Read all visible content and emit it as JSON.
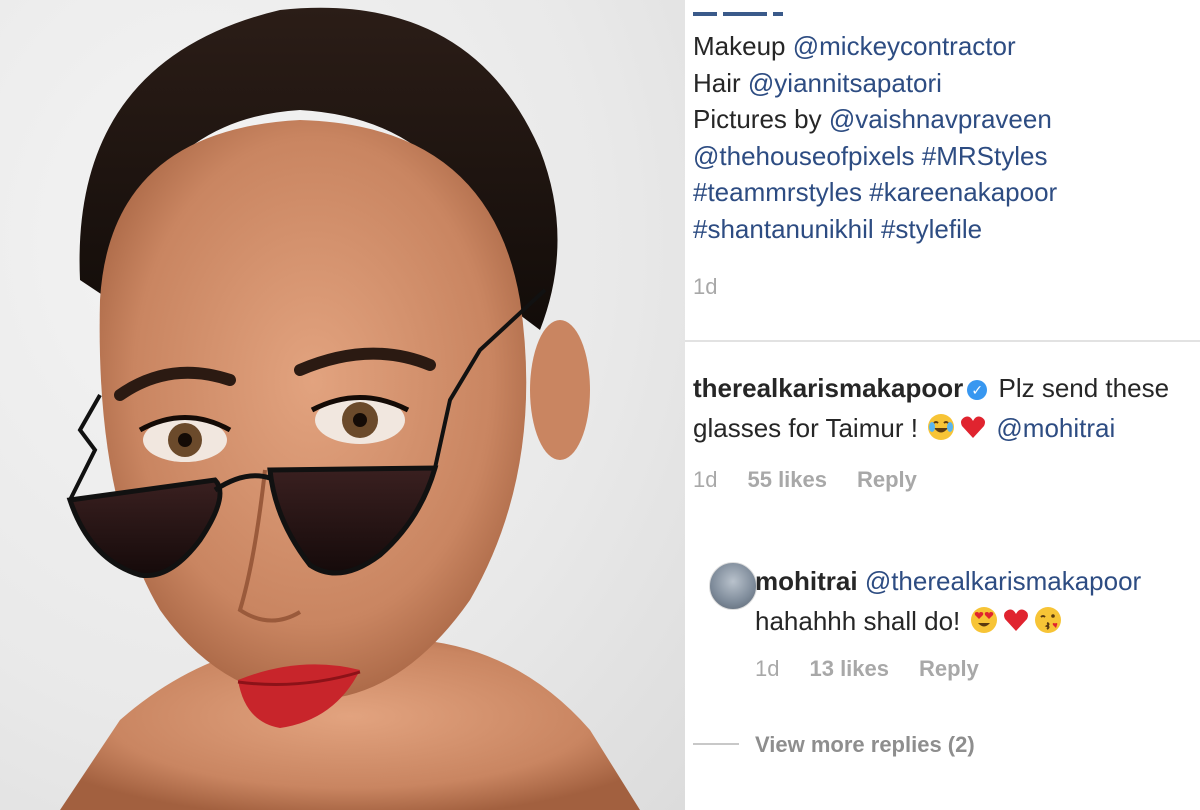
{
  "caption": {
    "lines": [
      [
        {
          "t": "Makeup ",
          "link": false
        },
        {
          "t": "@mickeycontractor",
          "link": true
        }
      ],
      [
        {
          "t": "Hair ",
          "link": false
        },
        {
          "t": "@yiannitsapatori",
          "link": true
        }
      ],
      [
        {
          "t": "Pictures by ",
          "link": false
        },
        {
          "t": "@vaishnavpraveen",
          "link": true
        }
      ],
      [
        {
          "t": "@thehouseofpixels",
          "link": true
        },
        {
          "t": " ",
          "link": false
        },
        {
          "t": "#MRStyles",
          "link": true
        }
      ],
      [
        {
          "t": "#teammrstyles",
          "link": true
        },
        {
          "t": " ",
          "link": false
        },
        {
          "t": "#kareenakapoor",
          "link": true
        }
      ],
      [
        {
          "t": "#shantanunikhil",
          "link": true
        },
        {
          "t": " ",
          "link": false
        },
        {
          "t": "#stylefile",
          "link": true
        }
      ]
    ],
    "time": "1d"
  },
  "comment1": {
    "username": "therealkarismakapoor",
    "text_before": " Plz send these glasses for Taimur ! ",
    "mention": "@mohitrai",
    "time": "1d",
    "likes": "55 likes",
    "reply": "Reply"
  },
  "comment2": {
    "username": "mohitrai",
    "mention": "@therealkarismakapoor",
    "text": "hahahhh shall do! ",
    "time": "1d",
    "likes": "13 likes",
    "reply": "Reply"
  },
  "view_more": "View more replies (2)",
  "colors": {
    "link": "#2d4c82",
    "text": "#262626",
    "muted": "#a8a8a8",
    "verified": "#3897f0",
    "heart": "#e0242f"
  },
  "icons": [
    "verified-badge-icon",
    "laughing-tears-emoji",
    "red-heart-emoji",
    "heart-eyes-emoji",
    "kiss-emoji",
    "user-avatar"
  ]
}
